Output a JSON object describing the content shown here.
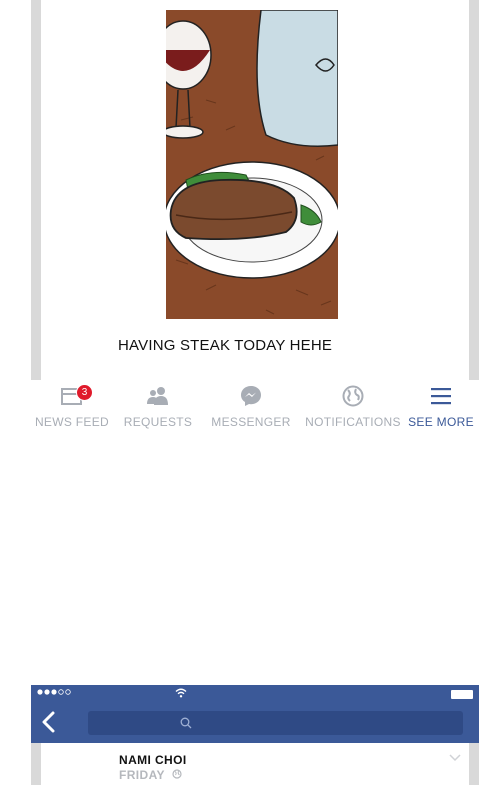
{
  "post": {
    "caption": "HAVING STEAK TODAY HEHE",
    "image_icon": "steak-dinner-illustration"
  },
  "tabbar": {
    "items": [
      {
        "label": "NEWS FEED",
        "icon": "news-feed-icon",
        "badge": "3",
        "active": false
      },
      {
        "label": "REQUESTS",
        "icon": "friend-requests-icon",
        "active": false
      },
      {
        "label": "MESSENGER",
        "icon": "messenger-icon",
        "active": false
      },
      {
        "label": "NOTIFICATIONS",
        "icon": "globe-icon",
        "active": false
      },
      {
        "label": "SEE MORE",
        "icon": "menu-icon",
        "active": true
      }
    ]
  },
  "next_post": {
    "author": "NAMI CHOI",
    "time": "FRIDAY"
  },
  "colors": {
    "brand": "#3b5998",
    "badge": "#e01a2b",
    "inactive": "#a8adb5"
  }
}
